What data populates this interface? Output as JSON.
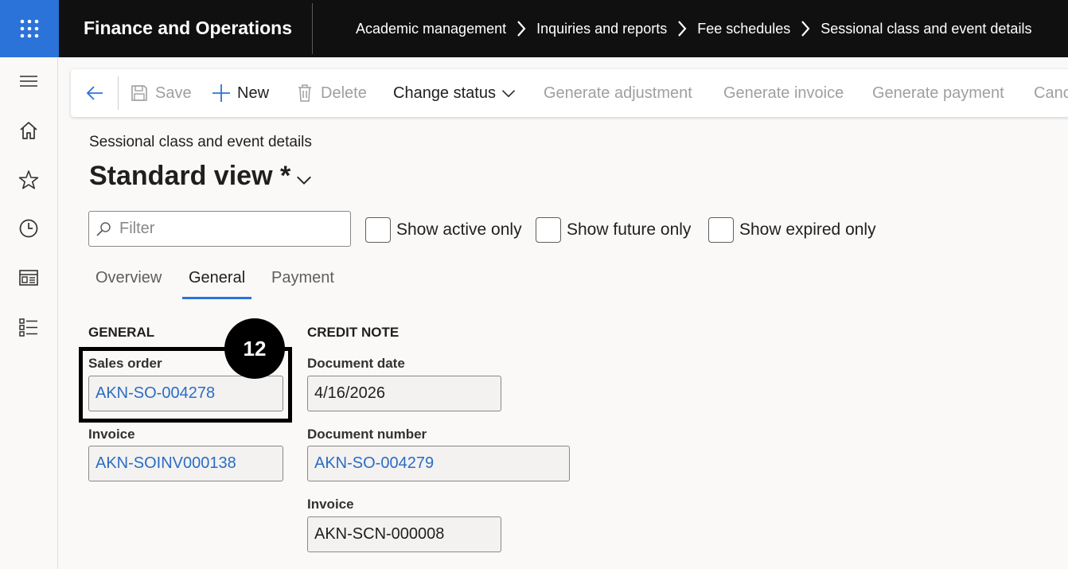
{
  "topbar": {
    "app_name": "Finance and Operations",
    "breadcrumbs": [
      "Academic management",
      "Inquiries and reports",
      "Fee schedules",
      "Sessional class and event details"
    ]
  },
  "leftnav": {
    "items": [
      "hamburger-icon",
      "home-icon",
      "star-icon",
      "clock-icon",
      "workspace-icon",
      "list-icon"
    ]
  },
  "toolbar": {
    "save_label": "Save",
    "new_label": "New",
    "delete_label": "Delete",
    "change_status_label": "Change status",
    "generate_adjustment_label": "Generate adjustment",
    "generate_invoice_label": "Generate invoice",
    "generate_payment_label": "Generate payment",
    "cancel_label": "Canc"
  },
  "form": {
    "caption": "Sessional class and event details",
    "view_name": "Standard view *",
    "filter_placeholder": "Filter",
    "checkboxes": {
      "active": "Show active only",
      "future": "Show future only",
      "expired": "Show expired only"
    },
    "tabs": [
      "Overview",
      "General",
      "Payment"
    ],
    "selected_tab": "General"
  },
  "general": {
    "title": "GENERAL",
    "sales_order_label": "Sales order",
    "sales_order_value": "AKN-SO-004278",
    "invoice_label": "Invoice",
    "invoice_value": "AKN-SOINV000138"
  },
  "credit_note": {
    "title": "CREDIT NOTE",
    "document_date_label": "Document date",
    "document_date_value": "4/16/2026",
    "document_number_label": "Document number",
    "document_number_value": "AKN-SO-004279",
    "invoice_label": "Invoice",
    "invoice_value": "AKN-SCN-000008"
  },
  "annotation": {
    "step_number": "12"
  },
  "colors": {
    "accent": "#2b73d9",
    "link": "#2b6cc4",
    "topbar": "#101010"
  }
}
